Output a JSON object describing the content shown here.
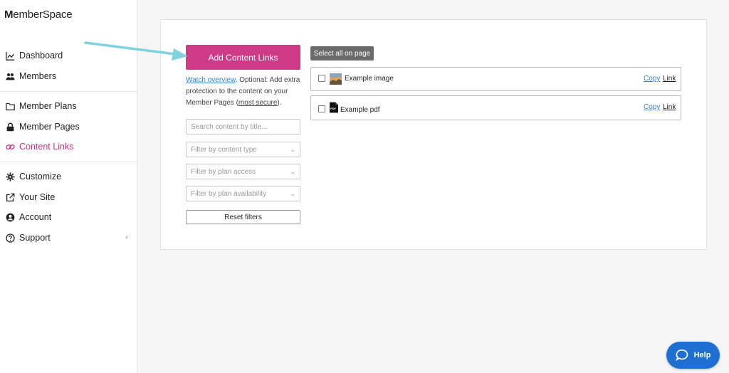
{
  "brand": {
    "first": "M",
    "rest": "emberSpace"
  },
  "nav": {
    "dashboard": "Dashboard",
    "members": "Members",
    "member_plans": "Member Plans",
    "member_pages": "Member Pages",
    "content_links": "Content Links",
    "customize": "Customize",
    "your_site": "Your Site",
    "account": "Account",
    "support": "Support",
    "collapse_glyph": "‹"
  },
  "actions": {
    "add_content_links": "Add Content Links",
    "reset_filters": "Reset filters",
    "select_all": "Select all on page"
  },
  "help": {
    "watch": "Watch overview",
    "text1": ". Optional: Add extra protection to the content on your Member Pages (",
    "most_secure": "most secure",
    "text2": ")."
  },
  "filters": {
    "search_placeholder": "Search content by title...",
    "content_type": "Filter by content type",
    "plan_access": "Filter by plan access",
    "plan_availability": "Filter by plan availability"
  },
  "items": [
    {
      "name": "Example image",
      "type": "image",
      "copy": "Copy",
      "link": "Link"
    },
    {
      "name": "Example pdf",
      "type": "pdf",
      "copy": "Copy",
      "link": "Link"
    }
  ],
  "help_widget": {
    "label": "Help"
  },
  "colors": {
    "accent": "#cf3a86",
    "active_nav": "#c6337f",
    "link": "#3b82c4",
    "help": "#1e6fd1",
    "arrow": "#7fd3e0"
  }
}
